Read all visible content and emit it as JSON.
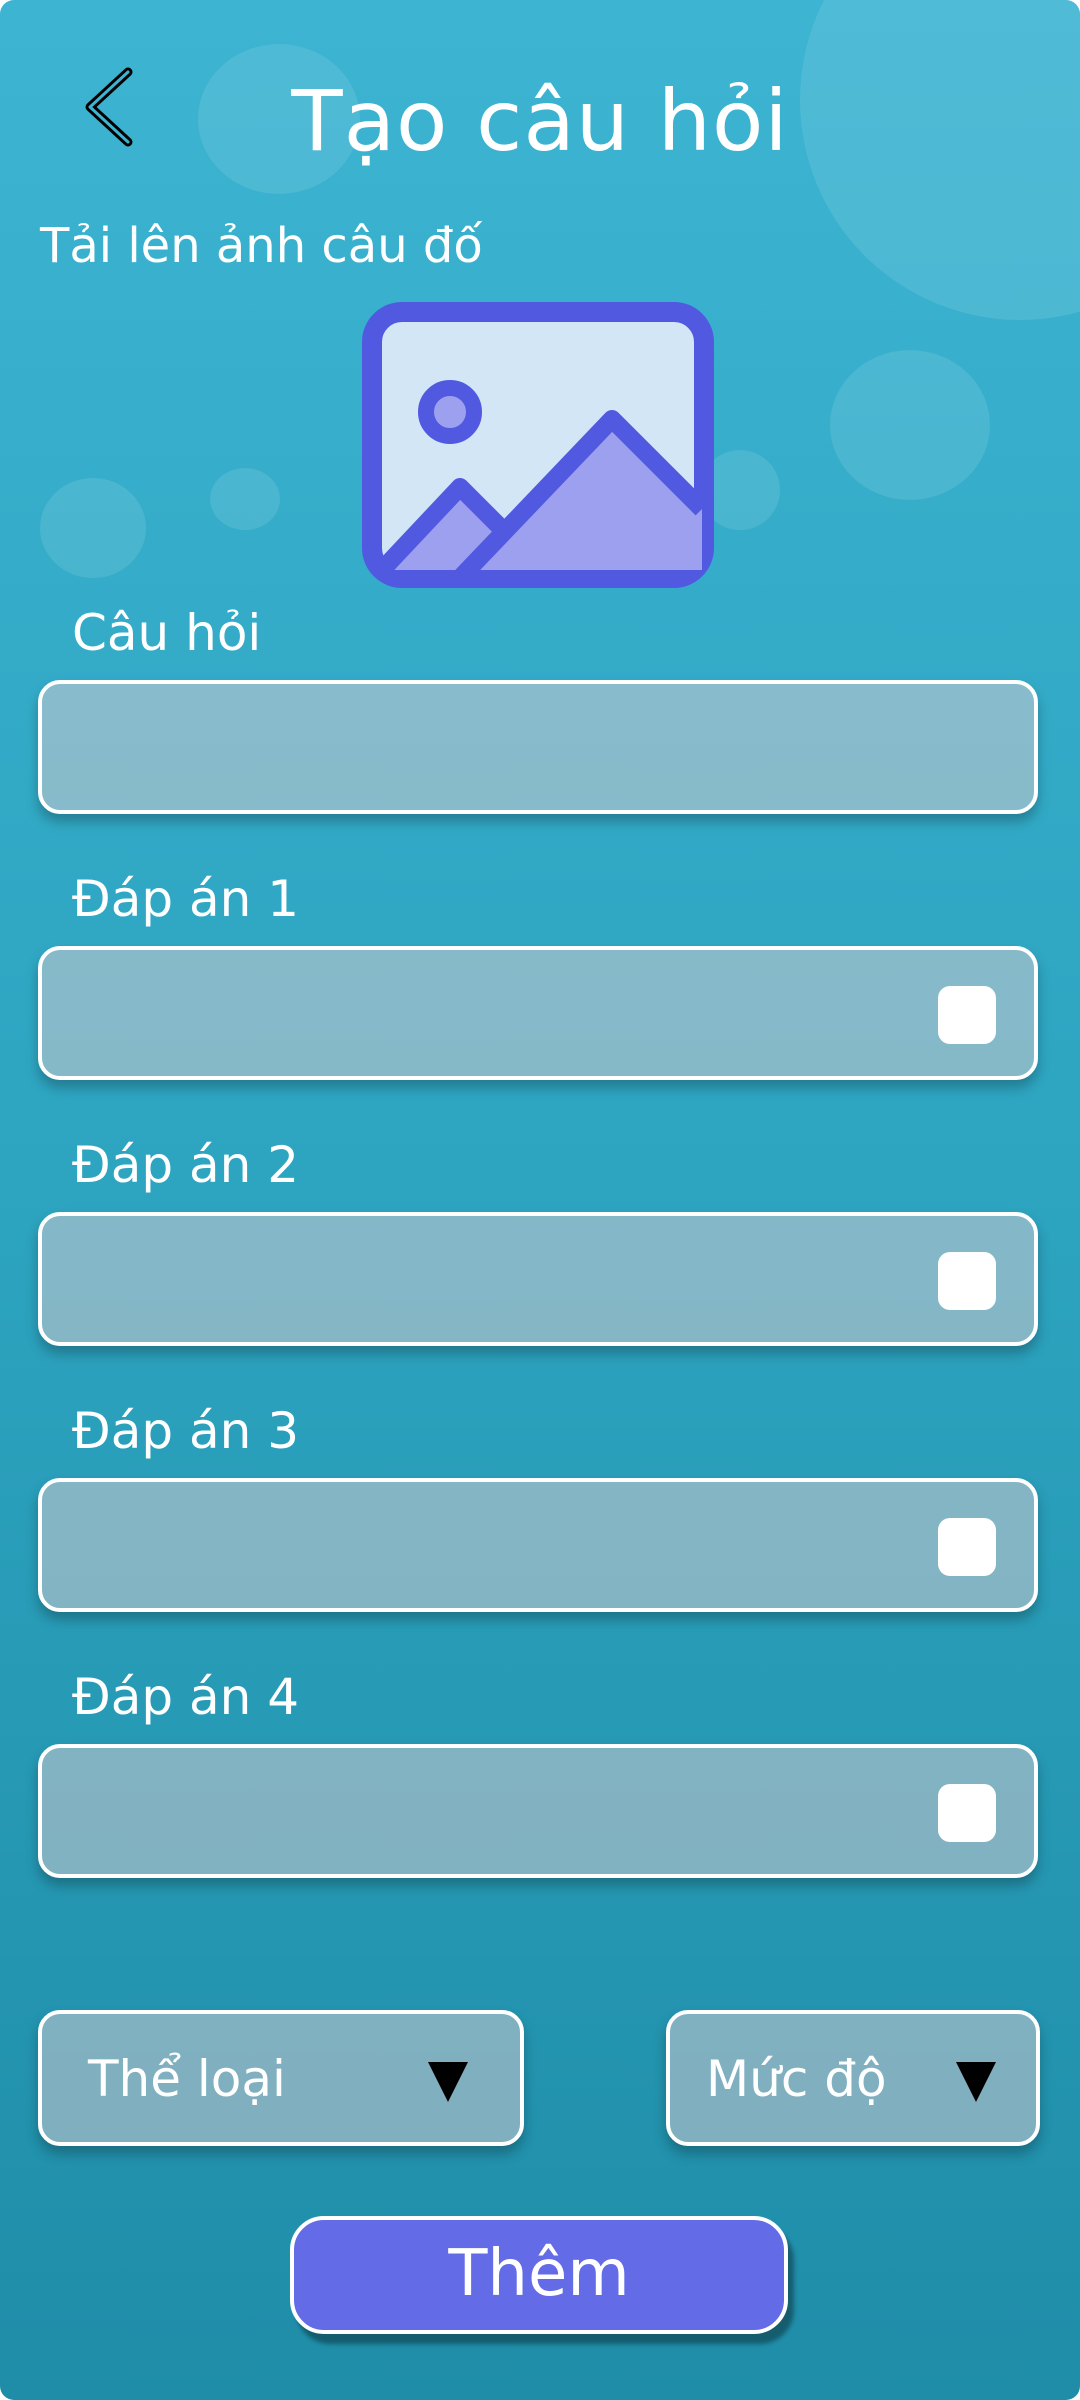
{
  "header": {
    "title": "Tạo câu hỏi"
  },
  "upload": {
    "label": "Tải lên ảnh câu đố",
    "icon": "image-icon"
  },
  "question": {
    "label": "Câu hỏi",
    "value": ""
  },
  "answers": [
    {
      "label": "Đáp án 1",
      "value": "",
      "correct": false
    },
    {
      "label": "Đáp án 2",
      "value": "",
      "correct": false
    },
    {
      "label": "Đáp án 3",
      "value": "",
      "correct": false
    },
    {
      "label": "Đáp án 4",
      "value": "",
      "correct": false
    }
  ],
  "selects": {
    "category": "Thể loại",
    "difficulty": "Mức độ"
  },
  "submit_label": "Thêm",
  "colors": {
    "background_top": "#3cb4d2",
    "background_bottom": "#1f8da8",
    "button": "#636be6",
    "icon_frame": "#5159e0",
    "icon_fill": "#d3e6f6",
    "icon_mountain": "#9ca0ef"
  }
}
